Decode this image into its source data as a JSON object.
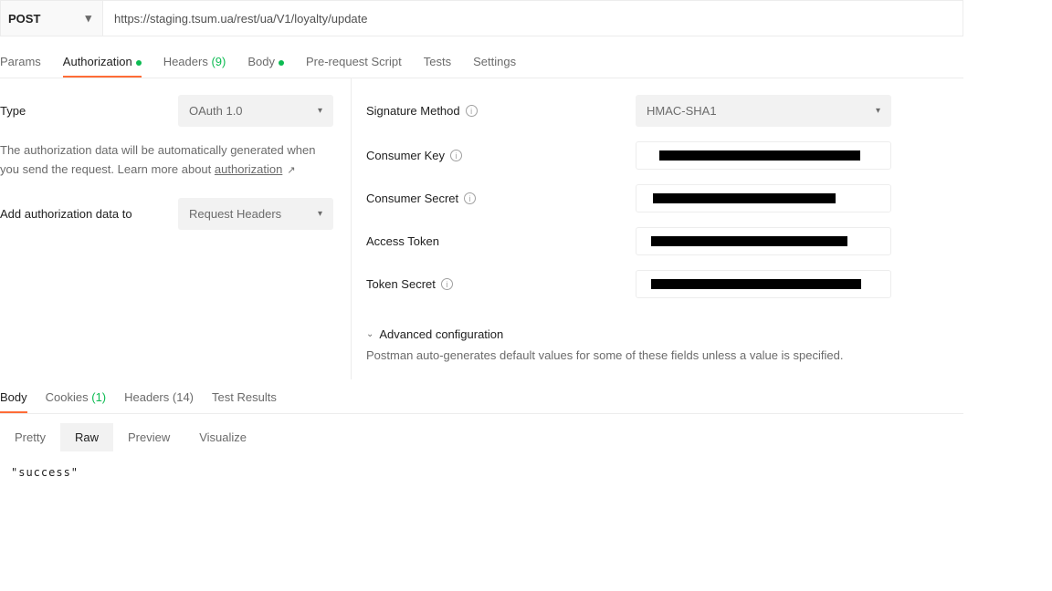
{
  "request": {
    "method": "POST",
    "url": "https://staging.tsum.ua/rest/ua/V1/loyalty/update"
  },
  "tabs": {
    "params": "Params",
    "authorization": "Authorization",
    "headers": "Headers",
    "headers_count": "(9)",
    "body": "Body",
    "prerequest": "Pre-request Script",
    "tests": "Tests",
    "settings": "Settings"
  },
  "auth": {
    "type_label": "Type",
    "type_value": "OAuth 1.0",
    "help1": "The authorization data will be automatically generated when you send the request. Learn more about ",
    "help_link": "authorization",
    "add_to_label": "Add authorization data to",
    "add_to_value": "Request Headers",
    "sig_method_label": "Signature Method",
    "sig_method_value": "HMAC-SHA1",
    "consumer_key_label": "Consumer Key",
    "consumer_secret_label": "Consumer Secret",
    "access_token_label": "Access Token",
    "token_secret_label": "Token Secret",
    "advanced": "Advanced configuration",
    "advanced_desc": "Postman auto-generates default values for some of these fields unless a value is specified."
  },
  "response_tabs": {
    "body": "Body",
    "cookies": "Cookies",
    "cookies_count": "(1)",
    "headers": "Headers",
    "headers_count": "(14)",
    "tests": "Test Results"
  },
  "view_tabs": {
    "pretty": "Pretty",
    "raw": "Raw",
    "preview": "Preview",
    "visualize": "Visualize"
  },
  "response_body": "\"success\""
}
